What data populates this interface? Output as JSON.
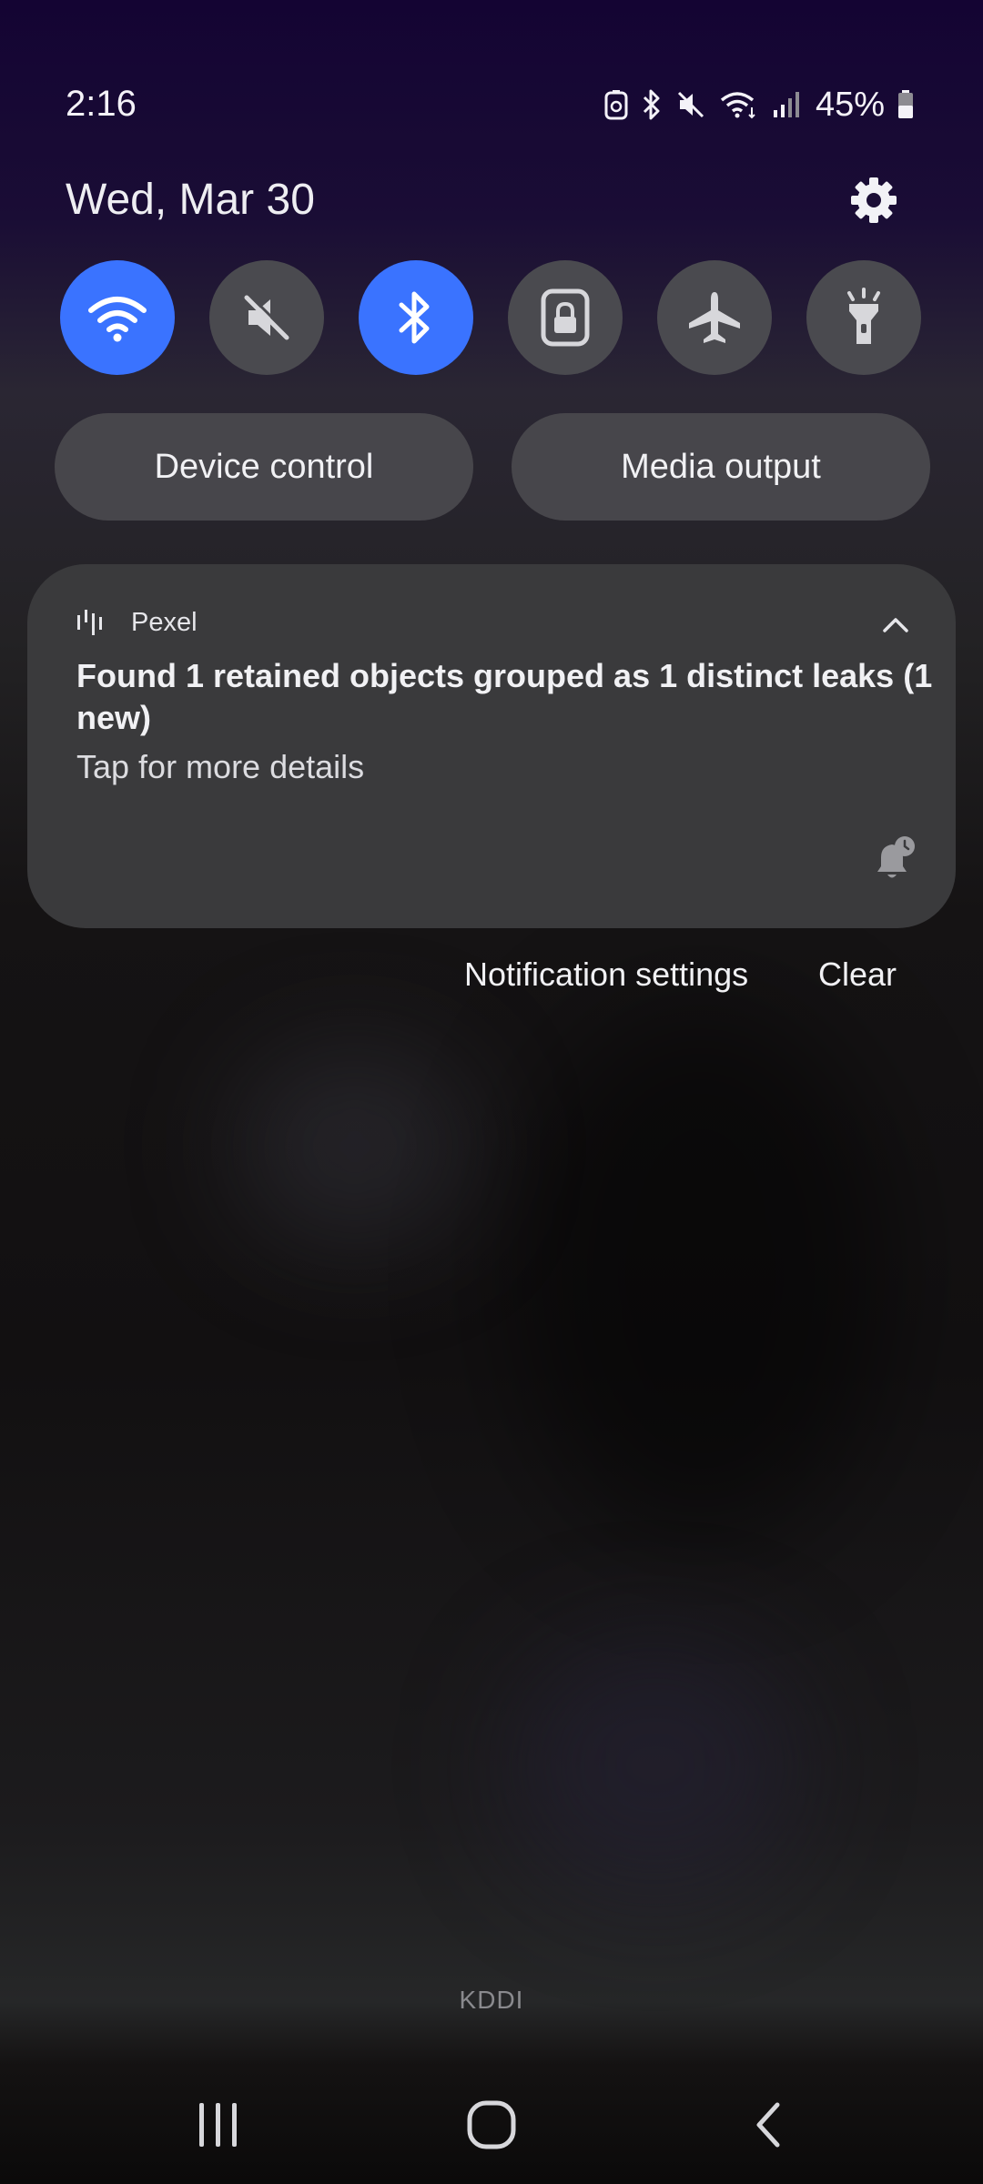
{
  "status_bar": {
    "time": "2:16",
    "battery_percent": "45%",
    "icons": [
      "recycle-notification-icon",
      "bluetooth-icon",
      "mute-icon",
      "wifi-icon",
      "signal-icon",
      "battery-icon"
    ]
  },
  "panel": {
    "date": "Wed, Mar 30",
    "settings_icon": "gear-icon"
  },
  "quick_toggles": [
    {
      "name": "wifi",
      "icon": "wifi-icon",
      "on": true
    },
    {
      "name": "sound",
      "icon": "mute-icon",
      "on": false
    },
    {
      "name": "bluetooth",
      "icon": "bluetooth-icon",
      "on": true
    },
    {
      "name": "screen-rotation-lock",
      "icon": "lock-icon",
      "on": false
    },
    {
      "name": "airplane-mode",
      "icon": "airplane-icon",
      "on": false
    },
    {
      "name": "flashlight",
      "icon": "flashlight-icon",
      "on": false
    }
  ],
  "buttons": {
    "device_control": "Device control",
    "media_output": "Media output"
  },
  "notification": {
    "app_name": "Pexel",
    "title": "Found 1 retained objects grouped as 1 distinct leaks (1 new)",
    "body": "Tap for more details"
  },
  "actions": {
    "settings_label": "Notification settings",
    "clear_label": "Clear"
  },
  "carrier": "KDDI",
  "colors": {
    "toggle_on": "#3a73ff",
    "toggle_off": "#4a4a4f",
    "card_bg": "#3a3a3c"
  }
}
